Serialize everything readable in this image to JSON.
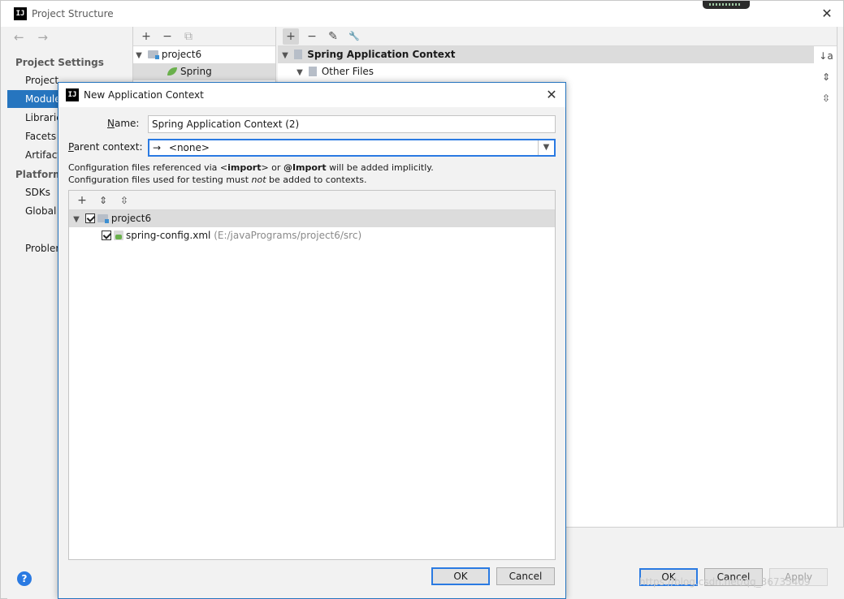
{
  "window": {
    "title": "Project Structure",
    "logo": "IJ",
    "close_glyph": "✕"
  },
  "nav": {
    "back_glyph": "←",
    "forward_glyph": "→",
    "section_project_settings": "Project Settings",
    "items_project": [
      "Project",
      "Modules",
      "Libraries",
      "Facets",
      "Artifacts"
    ],
    "section_platform": "Platform",
    "items_platform": [
      "SDKs",
      "Global"
    ],
    "problems": "Problems",
    "help_glyph": "?"
  },
  "tree": {
    "add_glyph": "+",
    "remove_glyph": "−",
    "copy_glyph": "⧉",
    "root": "project6",
    "child": "Spring"
  },
  "context_panel": {
    "add_glyph": "+",
    "remove_glyph": "−",
    "edit_glyph": "✎",
    "wrench_glyph": "🔧",
    "root": "Spring Application Context",
    "child": "Other Files",
    "sort_glyph": "↓a",
    "expand_glyph": "⇕",
    "collapse_glyph": "⇳"
  },
  "main_buttons": {
    "ok": "OK",
    "cancel": "Cancel",
    "apply": "Apply"
  },
  "watermark": "https://blog.csdn.net/qq_36735409",
  "dialog": {
    "title": "New Application Context",
    "close_glyph": "✕",
    "name_label_u": "N",
    "name_label_rest": "ame:",
    "name_value": "Spring Application Context (2)",
    "parent_label_u": "P",
    "parent_label_rest": "arent context:",
    "parent_arrow": "→",
    "parent_value": "<none>",
    "info1_a": "Configuration files referenced via <",
    "info1_b": "import",
    "info1_c": "> or ",
    "info1_d": "@Import",
    "info1_e": " will be added implicitly.",
    "info2_a": "Configuration files used for testing must ",
    "info2_b": "not",
    "info2_c": " be added to contexts.",
    "files": {
      "add_glyph": "+",
      "expand_glyph": "⇕",
      "collapse_glyph": "⇳",
      "root": "project6",
      "file_name": "spring-config.xml",
      "file_path": "(E:/javaPrograms/project6/src)"
    },
    "ok": "OK",
    "cancel": "Cancel"
  }
}
